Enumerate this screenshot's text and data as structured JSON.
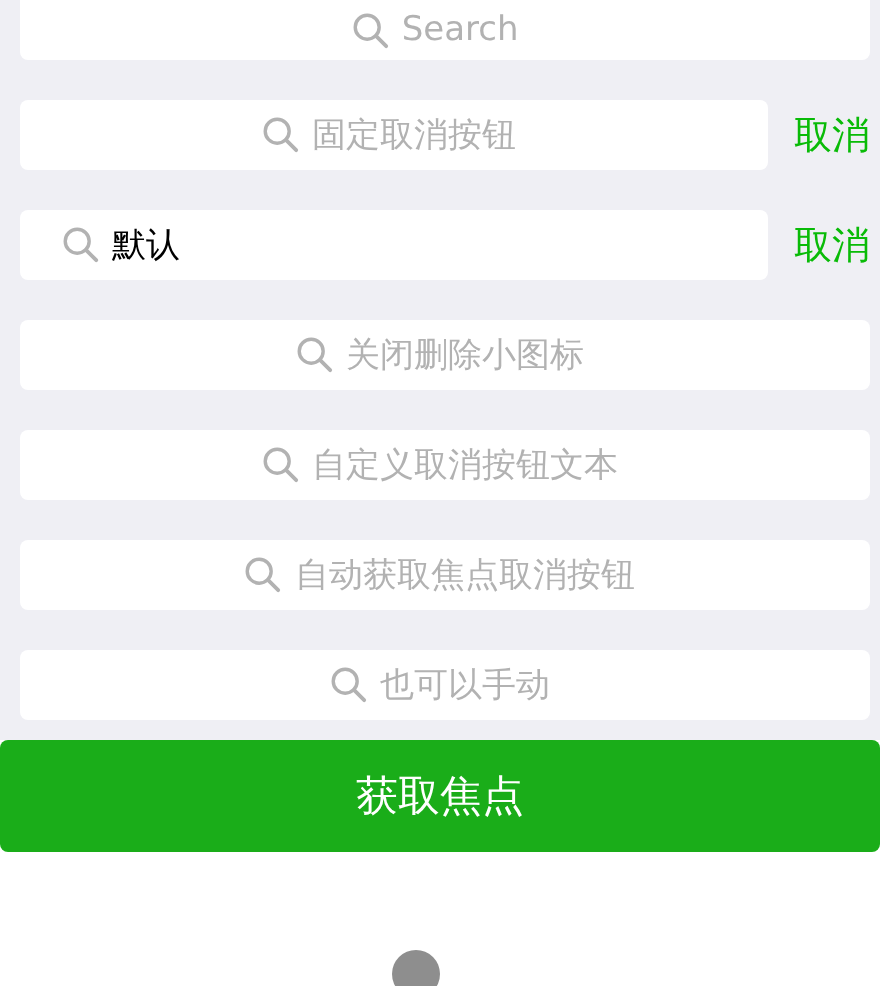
{
  "search_bars": [
    {
      "placeholder": "Search"
    },
    {
      "placeholder": "固定取消按钮",
      "cancel": "取消"
    },
    {
      "value": "默认",
      "cancel": "取消"
    },
    {
      "placeholder": "关闭删除小图标"
    },
    {
      "placeholder": "自定义取消按钮文本"
    },
    {
      "placeholder": "自动获取焦点取消按钮"
    },
    {
      "placeholder": "也可以手动"
    }
  ],
  "focus_button": "获取焦点"
}
